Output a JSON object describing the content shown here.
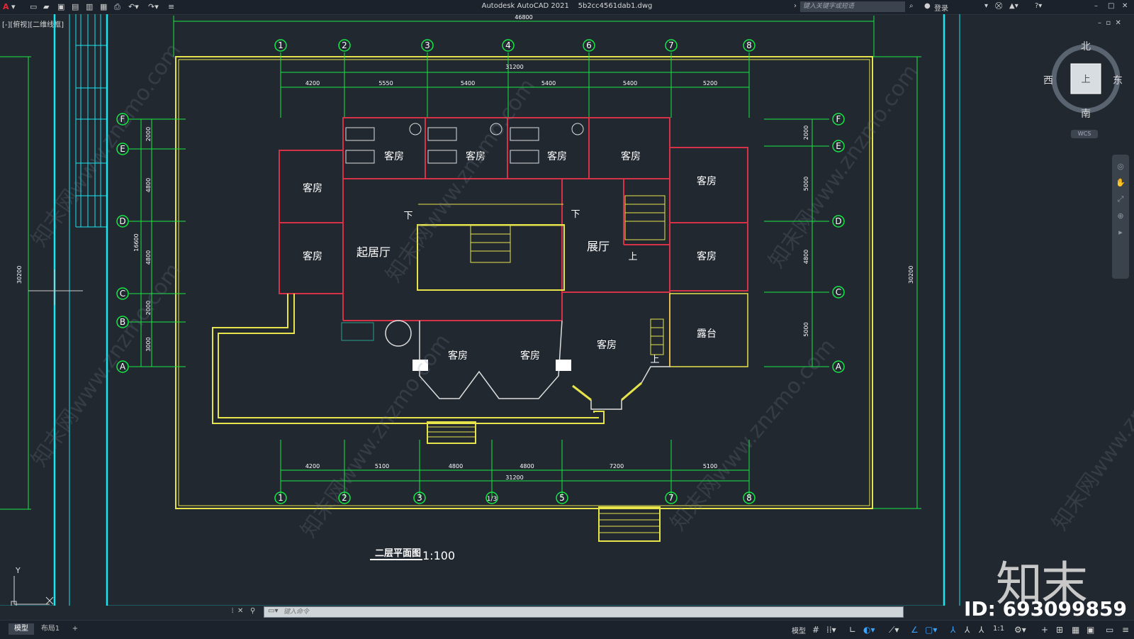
{
  "app": {
    "name": "Autodesk AutoCAD 2021",
    "file": "5b2cc4561dab1.dwg"
  },
  "search": {
    "placeholder": "键入关键字或短语"
  },
  "user": {
    "login": "登录"
  },
  "view": {
    "label": "[-][俯视][二维线框]"
  },
  "compass": {
    "north": "北",
    "south": "南",
    "east": "东",
    "west": "西",
    "top": "上",
    "wcs": "WCS"
  },
  "plan": {
    "title": "二层平面图",
    "scale": "1:100",
    "overall_top": "46800",
    "overall_width": "31200",
    "overall_height_left": "16600",
    "outer_height": "30200",
    "top_dims": [
      "4200",
      "5550",
      "5400",
      "5400",
      "5400",
      "5200"
    ],
    "bottom_dims": [
      "4200",
      "5100",
      "4800",
      "4800",
      "7200",
      "5100"
    ],
    "left_dims": [
      "2000",
      "4800",
      "4800",
      "2000",
      "3000"
    ],
    "right_dims": [
      "2000",
      "5000",
      "4800",
      "5000"
    ],
    "axes_top": [
      "1",
      "2",
      "3",
      "4",
      "6",
      "7",
      "8"
    ],
    "axes_bottom": [
      "1",
      "2",
      "3",
      "1/3",
      "5",
      "7",
      "8"
    ],
    "axes_left": [
      "F",
      "E",
      "D",
      "C",
      "B",
      "A"
    ],
    "axes_right": [
      "F",
      "E",
      "D",
      "C",
      "A"
    ],
    "rooms": {
      "guest": "客房",
      "living": "起居厅",
      "hall": "展厅",
      "terrace": "露台",
      "down": "下",
      "up": "上"
    }
  },
  "command": {
    "placeholder": "键入命令"
  },
  "tabs": {
    "model": "模型",
    "layout1": "布局1",
    "add": "+"
  },
  "status": {
    "model": "模型",
    "scale": "1:1"
  },
  "watermark": {
    "logo": "知末",
    "id": "ID: 693099859",
    "site": "知末网www.znzmo.com"
  }
}
